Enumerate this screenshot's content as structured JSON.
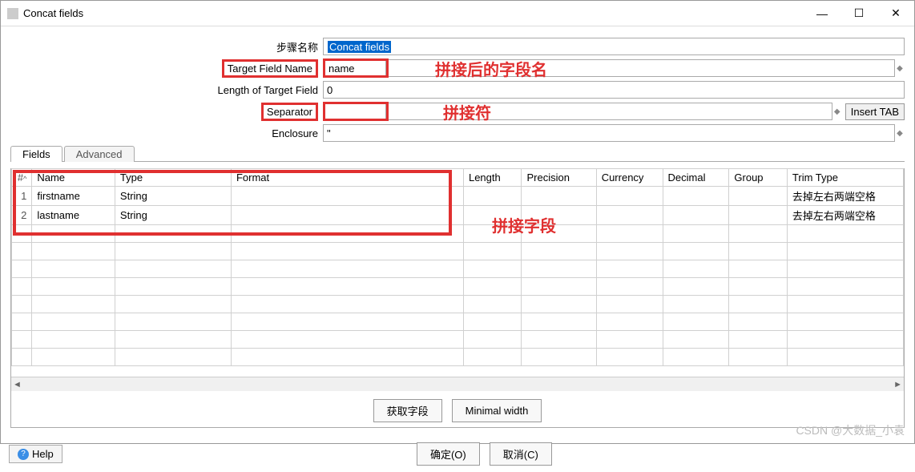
{
  "window": {
    "title": "Concat fields"
  },
  "form": {
    "step_name_label": "步骤名称",
    "step_name_value": "Concat fields",
    "target_field_label": "Target Field Name",
    "target_field_value": "name",
    "length_label": "Length of Target Field",
    "length_value": "0",
    "separator_label": "Separator",
    "separator_value": "",
    "enclosure_label": "Enclosure",
    "enclosure_value": "\"",
    "insert_tab_label": "Insert TAB"
  },
  "annotations": {
    "target_field": "拼接后的字段名",
    "separator": "拼接符",
    "fields": "拼接字段"
  },
  "tabs": {
    "fields": "Fields",
    "advanced": "Advanced"
  },
  "table": {
    "headers": {
      "hash": "#",
      "name": "Name",
      "type": "Type",
      "format": "Format",
      "length": "Length",
      "precision": "Precision",
      "currency": "Currency",
      "decimal": "Decimal",
      "group": "Group",
      "trim": "Trim Type"
    },
    "rows": [
      {
        "n": "1",
        "name": "firstname",
        "type": "String",
        "format": "",
        "length": "",
        "precision": "",
        "currency": "",
        "decimal": "",
        "group": "",
        "trim": "去掉左右两端空格"
      },
      {
        "n": "2",
        "name": "lastname",
        "type": "String",
        "format": "",
        "length": "",
        "precision": "",
        "currency": "",
        "decimal": "",
        "group": "",
        "trim": "去掉左右两端空格"
      }
    ]
  },
  "buttons": {
    "get_fields": "获取字段",
    "min_width": "Minimal width",
    "ok": "确定(O)",
    "cancel": "取消(C)",
    "help": "Help"
  },
  "watermark": "CSDN @大数据_小袁"
}
